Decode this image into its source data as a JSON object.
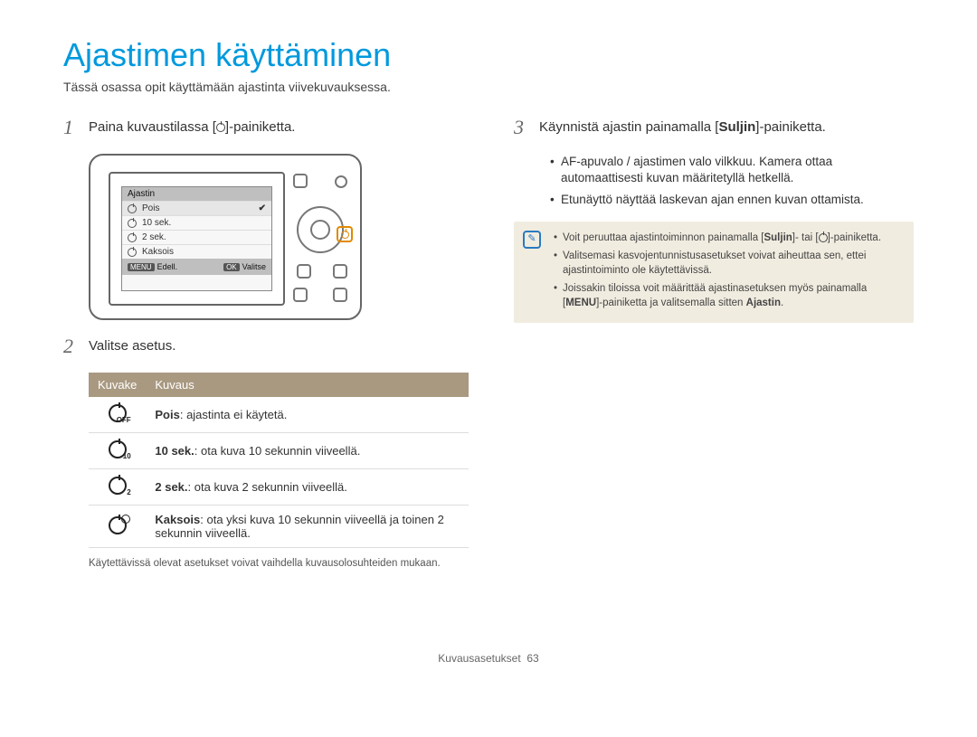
{
  "title": "Ajastimen käyttäminen",
  "subtitle": "Tässä osassa opit käyttämään ajastinta viivekuvauksessa.",
  "steps": {
    "s1": {
      "num": "1",
      "pre": "Paina kuvaustilassa [",
      "post": "]-painiketta."
    },
    "s2": {
      "num": "2",
      "text": "Valitse asetus."
    },
    "s3": {
      "num": "3",
      "pre": "Käynnistä ajastin painamalla [",
      "bold": "Suljin",
      "post": "]-painiketta."
    }
  },
  "lcd": {
    "title": "Ajastin",
    "rows": [
      "Pois",
      "10 sek.",
      "2 sek.",
      "Kaksois"
    ],
    "foot_left_tag": "MENU",
    "foot_left": "Edell.",
    "foot_right_tag": "OK",
    "foot_right": "Valitse"
  },
  "table": {
    "h1": "Kuvake",
    "h2": "Kuvaus",
    "rows": [
      {
        "sub": "OFF",
        "bold": "Pois",
        "rest": ": ajastinta ei käytetä."
      },
      {
        "sub": "10",
        "bold": "10 sek.",
        "rest": ": ota kuva 10 sekunnin viiveellä."
      },
      {
        "sub": "2",
        "bold": "2 sek.",
        "rest": ": ota kuva 2 sekunnin viiveellä."
      },
      {
        "sub": "",
        "bold": "Kaksois",
        "rest": ": ota yksi kuva 10 sekunnin viiveellä ja toinen 2 sekunnin viiveellä.",
        "double": true
      }
    ]
  },
  "note_below_table": "Käytettävissä olevat asetukset voivat vaihdella kuvausolosuhteiden mukaan.",
  "right_bullets": [
    "AF-apuvalo / ajastimen valo vilkkuu. Kamera ottaa automaattisesti kuvan määritetyllä hetkellä.",
    "Etunäyttö näyttää laskevan ajan ennen kuvan ottamista."
  ],
  "infobox": {
    "i1_pre": "Voit peruuttaa ajastintoiminnon painamalla [",
    "i1_b1": "Suljin",
    "i1_mid": "]- tai [",
    "i1_post": "]-painiketta.",
    "i2": "Valitsemasi kasvojentunnistusasetukset voivat aiheuttaa sen, ettei ajastintoiminto ole käytettävissä.",
    "i3_pre": "Joissakin tiloissa voit määrittää ajastinasetuksen myös painamalla [",
    "i3_b1": "MENU",
    "i3_mid": "]-painiketta ja valitsemalla sitten ",
    "i3_b2": "Ajastin",
    "i3_post": "."
  },
  "footer": {
    "label": "Kuvausasetukset",
    "page": "63"
  }
}
